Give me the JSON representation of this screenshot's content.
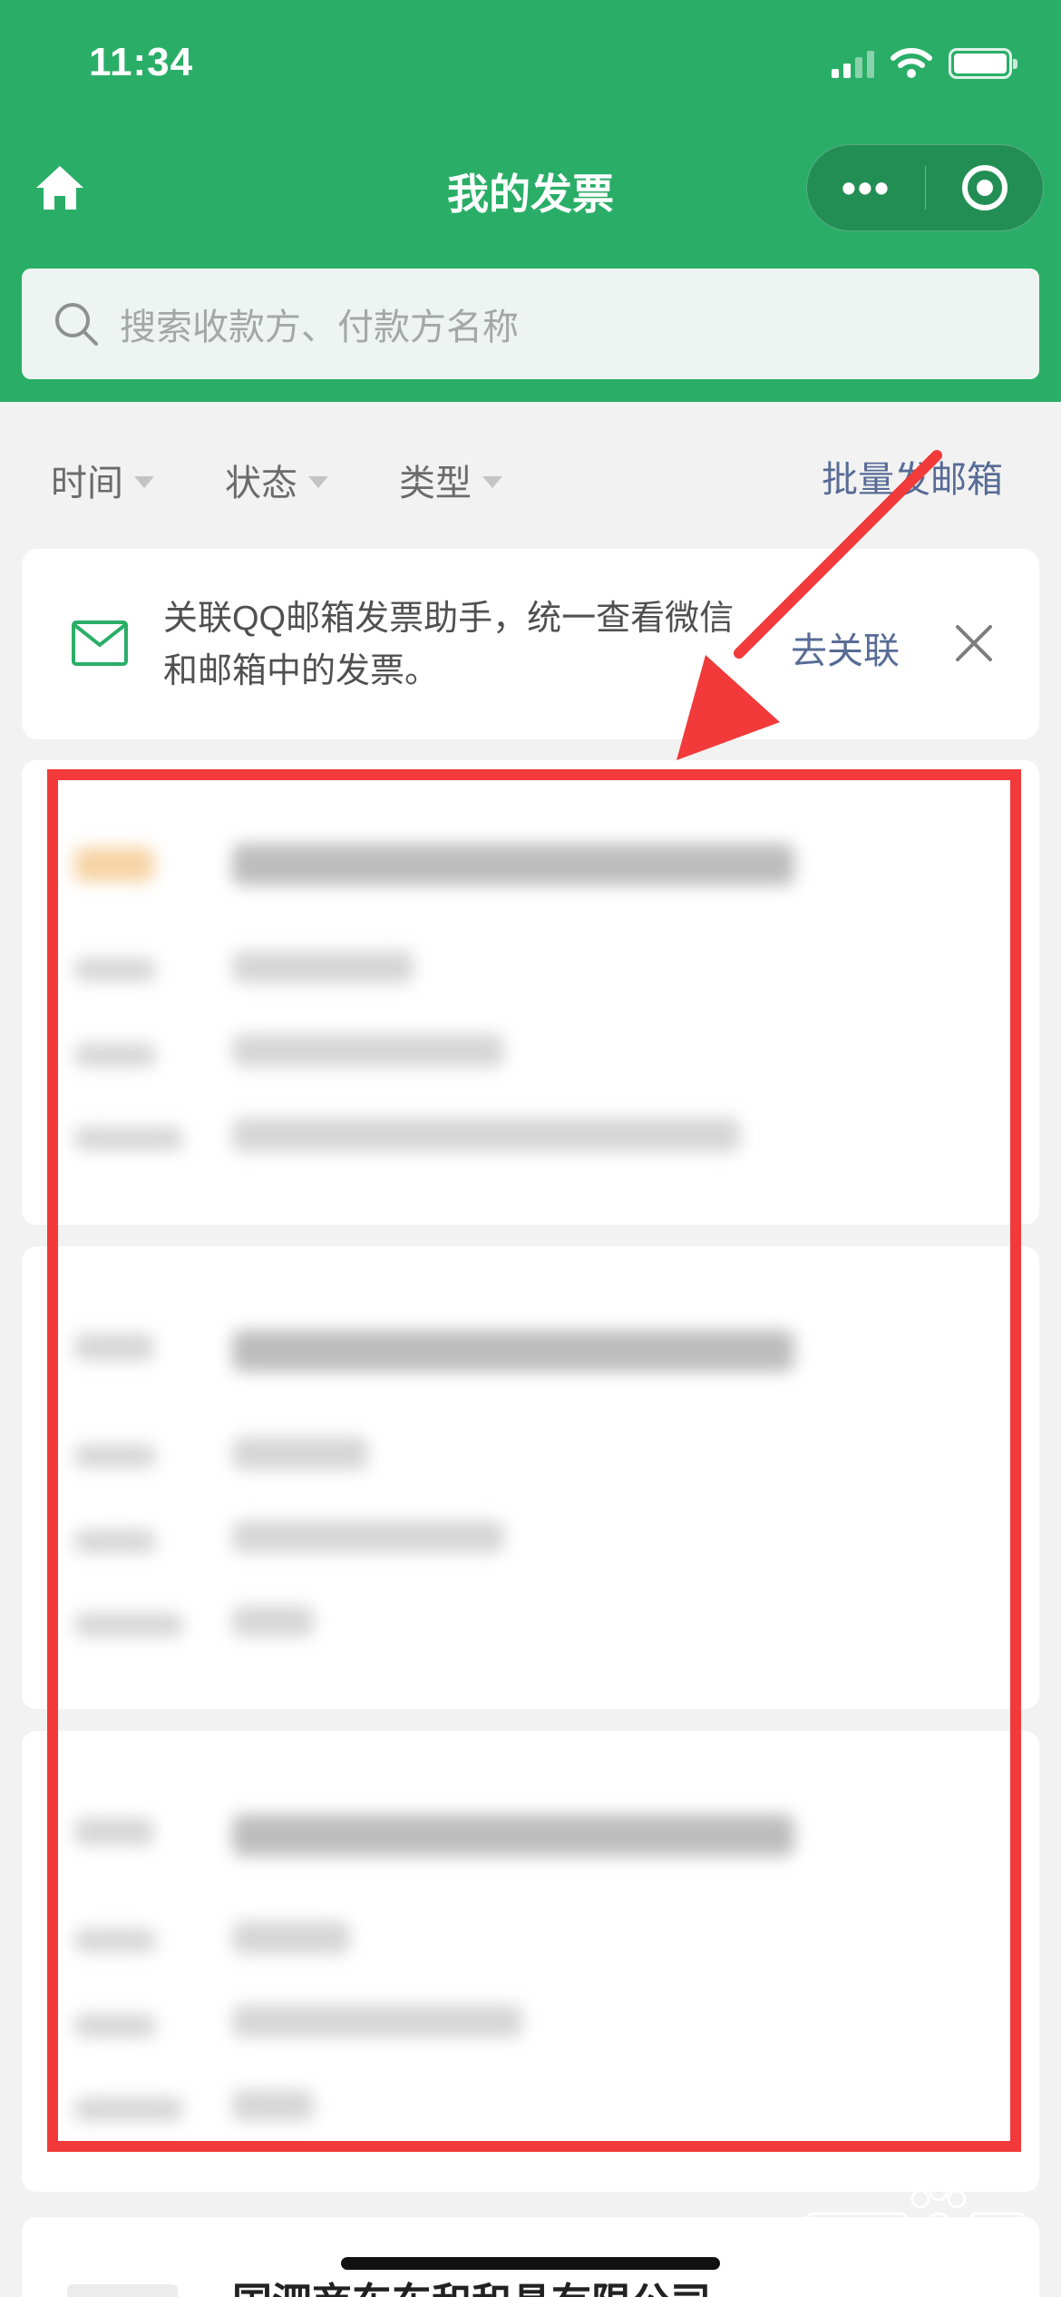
{
  "status_bar": {
    "time": "11:34"
  },
  "nav": {
    "title": "我的发票",
    "more_label": "•••"
  },
  "search": {
    "placeholder": "搜索收款方、付款方名称"
  },
  "filters": [
    {
      "label": "时间"
    },
    {
      "label": "状态"
    },
    {
      "label": "类型"
    }
  ],
  "batch_email_label": "批量发邮箱",
  "banner": {
    "text": "关联QQ邮箱发票助手，统一查看微信和邮箱中的发票。",
    "link_label": "去关联"
  },
  "partial_card_title": "国泗商东东和和具有限公司",
  "colors": {
    "brand_green": "#2aae67",
    "link_blue": "#576b95",
    "annotation_red": "#f23a3a"
  },
  "icons": [
    "home-icon",
    "more-icon",
    "target-icon",
    "search-icon",
    "mail-icon",
    "close-icon"
  ]
}
